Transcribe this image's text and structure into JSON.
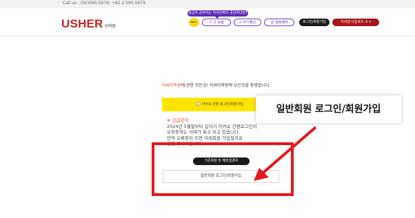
{
  "topbar": {
    "contact": "Call us : (02)595-5679, +82 2 595-5679"
  },
  "header": {
    "logo": "USHER",
    "logo_sub": "어학원",
    "tooltip": "중급자 공부하는 어셔진짜이 궁금하다면?",
    "nav": {
      "kakao": "TALK",
      "test": "나 모델",
      "schedule": "수기확인",
      "consult": "상담예약",
      "login": "로그인/회원가입",
      "app_download": "어셔앱 다운로드"
    }
  },
  "main": {
    "welcome_accent": "어셔어학원",
    "welcome_rest": "에 관한 모든것! 어셔어학원에 오신것을 환영합니다.",
    "kakao_button": "카카오 간편 로그인/회원가입",
    "notice_title": "※ 긴급공지",
    "notice_lines": [
      "2024년 5월말부터 갑자기 카카오 간편로그인이",
      "오작동하는 사례가 보고 되고 있습니다.",
      "만약 오류창이 뜨면 아래회원 가입절차로",
      "진행 부탁드립니다."
    ],
    "section_pill": "기존회원 및 해외일경우",
    "general_login": "일반회원 로그인/회원가입"
  },
  "overlay": {
    "label": "일반회원 로그인/회원가입"
  },
  "colors": {
    "brand_red": "#c8242b",
    "highlight_red": "#e8161d",
    "kakao_yellow": "#fee500",
    "purple": "#5b2bb5"
  }
}
